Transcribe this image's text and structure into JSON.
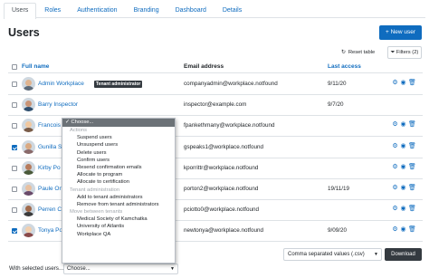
{
  "tabs": [
    "Users",
    "Roles",
    "Authentication",
    "Branding",
    "Dashboard",
    "Details"
  ],
  "page_title": "Users",
  "new_user_label": "+ New user",
  "reset_table_label": "Reset table",
  "filters_label": "Filters (2)",
  "table": {
    "headers": {
      "full_name": "Full name",
      "email": "Email address",
      "last_access": "Last access"
    },
    "rows": [
      {
        "name": "Admin Workplace",
        "badge": "Tenant administrator",
        "email": "companyadmin@workplace.notfound",
        "access": "9/11/20",
        "checked": false,
        "actions": true
      },
      {
        "name": "Barry Inspector",
        "email": "inspector@example.com",
        "access": "9/7/20",
        "checked": false,
        "actions": false
      },
      {
        "name": "Francois P",
        "email": "fpankethmany@workplace.notfound",
        "access": "",
        "checked": false,
        "actions": true
      },
      {
        "name": "Gunilla S",
        "email": "gspeaks1@workplace.notfound",
        "access": "",
        "checked": true,
        "actions": true
      },
      {
        "name": "Kirby Po",
        "email": "kporrittr@workplace.notfound",
        "access": "",
        "checked": false,
        "actions": true
      },
      {
        "name": "Paule Ort",
        "email": "porton2@workplace.notfound",
        "access": "19/11/19",
        "checked": false,
        "actions": true
      },
      {
        "name": "Perren Ci",
        "email": "pciotto0@workplace.notfound",
        "access": "",
        "checked": false,
        "actions": true
      },
      {
        "name": "Tonya Po",
        "email": "newtonya@workplace.notfound",
        "access": "9/09/20",
        "checked": true,
        "actions": true
      }
    ]
  },
  "bulk": {
    "label": "With selected users...",
    "selected": "Choose...",
    "choose_item": "✓ Choose...",
    "groups": [
      {
        "title": "Actions",
        "items": [
          "Suspend users",
          "Unsuspend users",
          "Delete users",
          "Confirm users",
          "Resend confirmation emails",
          "Allocate to program",
          "Allocate to certification"
        ]
      },
      {
        "title": "Tenant administration",
        "items": [
          "Add to tenant administrators",
          "Remove from tenant administrators"
        ]
      },
      {
        "title": "Move between tenants",
        "items": [
          "Medical Society of Kamchatka",
          "University of Atlantis",
          "Workplace QA"
        ]
      }
    ]
  },
  "download": {
    "format": "Comma separated values (.csv)",
    "button": "Download"
  },
  "colors": {
    "accent": "#0f6cbf",
    "dark": "#343a40",
    "border": "#dee2e6"
  },
  "icons": {
    "reset": "reset-icon",
    "filter": "filter-icon",
    "actions": [
      "cog-icon",
      "eye-icon",
      "trash-icon"
    ]
  }
}
